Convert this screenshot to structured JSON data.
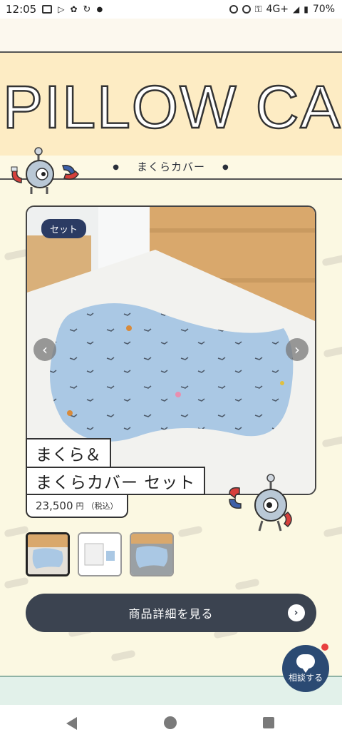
{
  "status_bar": {
    "time": "12:05",
    "network": "4G+",
    "battery": "70%"
  },
  "banner": {
    "title": "PILLOW CAS",
    "subtitle": "まくらカバー",
    "subtitle_dot": "●"
  },
  "product": {
    "badge": "セット",
    "name_line1": "まくら＆",
    "name_line2": "まくらカバー セット",
    "price": "23,500",
    "price_unit": "円",
    "price_tax": "（税込）",
    "prev_arrow": "‹",
    "next_arrow": "›",
    "thumbnails": [
      {
        "name": "thumb-pillow-set",
        "active": true
      },
      {
        "name": "thumb-pillow-package",
        "active": false
      },
      {
        "name": "thumb-pillow-cover",
        "active": false
      }
    ]
  },
  "cta": {
    "label": "商品詳細を見る",
    "arrow": "›"
  },
  "chat": {
    "label": "相談する"
  },
  "colors": {
    "banner_bg": "#fdecc4",
    "page_bg": "#fbf8e2",
    "cta_bg": "#3b4350",
    "badge_bg": "#2b3b63",
    "chat_bg": "#2b4a73",
    "pillow": "#aac8e4"
  }
}
